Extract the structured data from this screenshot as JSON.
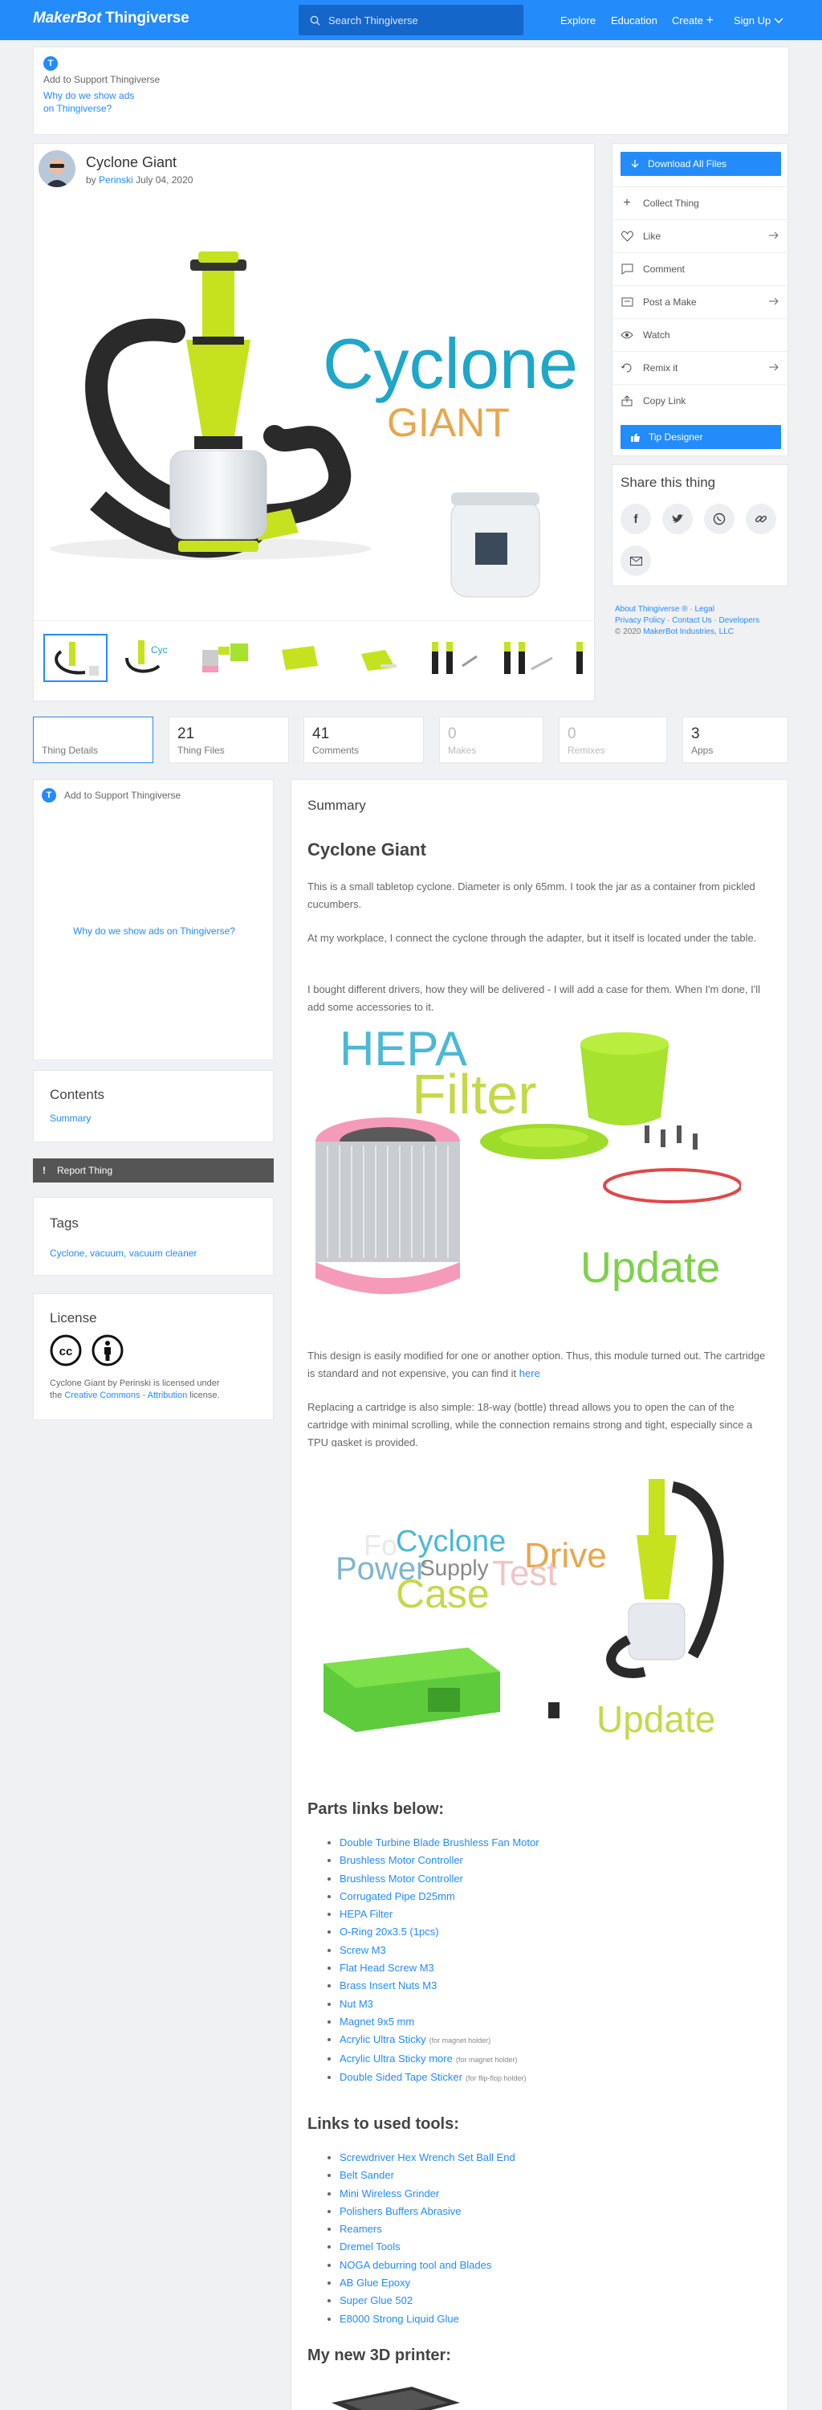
{
  "header": {
    "logo_a": "MakerBot",
    "logo_b": "Thingiverse",
    "search_placeholder": "Search Thingiverse",
    "nav": [
      "Explore",
      "Education",
      "Create",
      "Sign Up"
    ]
  },
  "ad_top": {
    "support": "Add to Support Thingiverse",
    "why_line1": "Why do we show ads",
    "why_line2": "on Thingiverse?"
  },
  "thing": {
    "title": "Cyclone Giant",
    "by": "by",
    "author": "Perinski",
    "date": "July 04, 2020",
    "hero_word1": "Cyclone",
    "hero_word2": "GIANT"
  },
  "actions": {
    "download": "Download All Files",
    "items": [
      "Collect Thing",
      "Like",
      "Comment",
      "Post a Make",
      "Watch",
      "Remix it",
      "Copy Link"
    ],
    "tip": "Tip Designer"
  },
  "share": {
    "title": "Share this thing"
  },
  "footer_links": {
    "line1a": "About Thingiverse ®",
    "line1b": "Legal",
    "line2a": "Privacy Policy",
    "line2b": "Contact Us",
    "line2c": "Developers",
    "copy": "© 2020",
    "company": "MakerBot Industries, LLC"
  },
  "tabs": [
    {
      "num": "",
      "label": "Thing Details"
    },
    {
      "num": "21",
      "label": "Thing Files"
    },
    {
      "num": "41",
      "label": "Comments"
    },
    {
      "num": "0",
      "label": "Makes"
    },
    {
      "num": "0",
      "label": "Remixes"
    },
    {
      "num": "3",
      "label": "Apps"
    }
  ],
  "side_ad": {
    "support": "Add to Support Thingiverse",
    "why": "Why do we show ads on Thingiverse?"
  },
  "contents": {
    "title": "Contents",
    "summary": "Summary"
  },
  "report": "Report Thing",
  "tags": {
    "title": "Tags",
    "list": "Cyclone, vacuum, vacuum cleaner"
  },
  "license": {
    "title": "License",
    "text1": "Cyclone Giant by Perinski is licensed under",
    "text2": "the",
    "link": "Creative Commons - Attribution",
    "text3": "license."
  },
  "summary": {
    "label": "Summary",
    "title": "Cyclone Giant",
    "p1": "This is a small tabletop cyclone. Diameter is only 65mm. I took the jar as a container from pickled cucumbers.",
    "p2": "At my workplace, I connect the cyclone through the adapter, but it itself is located under the table.",
    "p3": "I bought different drivers, how they will be delivered - I will add a case for them. When I'm done, I'll add some accessories to it.",
    "img1_w1": "HEPA",
    "img1_w2": "Filter",
    "img1_w3": "Update",
    "p4": "This design is easily modified for one or another option. Thus, this module turned out. The cartridge is standard and not expensive, you can find it",
    "p4_link": "here",
    "p5": "Replacing a cartridge is also simple: 18-way (bottle) thread allows you to open the can of the cartridge with minimal scrolling, while the connection remains strong and tight, especially since a TPU gasket is provided.",
    "img2_words": [
      "Fo",
      "Power",
      "Cyclone",
      "Supply",
      "Drive",
      "Case",
      "Test",
      "Update"
    ]
  },
  "parts": {
    "title": "Parts links below:",
    "items": [
      {
        "t": "Double Turbine Blade Brushless Fan Motor",
        "n": ""
      },
      {
        "t": "Brushless Motor Controller",
        "n": ""
      },
      {
        "t": "Brushless Motor Controller",
        "n": ""
      },
      {
        "t": "Corrugated Pipe D25mm",
        "n": ""
      },
      {
        "t": "HEPA Filter",
        "n": ""
      },
      {
        "t": "O-Ring 20x3.5 (1pcs)",
        "n": ""
      },
      {
        "t": "Screw M3",
        "n": ""
      },
      {
        "t": "Flat Head Screw M3",
        "n": ""
      },
      {
        "t": "Brass Insert Nuts M3",
        "n": ""
      },
      {
        "t": "Nut M3",
        "n": ""
      },
      {
        "t": "Magnet 9x5 mm",
        "n": ""
      },
      {
        "t": "Acrylic Ultra Sticky",
        "n": "(for magnet holder)"
      },
      {
        "t": "Acrylic Ultra Sticky more",
        "n": "(for magnet holder)"
      },
      {
        "t": "Double Sided Tape Sticker",
        "n": "(for flip-flop holder)"
      }
    ]
  },
  "tools": {
    "title": "Links to used tools:",
    "items": [
      "Screwdriver Hex Wrench Set Ball End",
      "Belt Sander",
      "Mini Wireless Grinder",
      "Polishers Buffers Abrasive",
      "Reamers",
      "Dremel Tools",
      "NOGA deburring tool and Blades",
      "AB Glue Epoxy",
      "Super Glue 502",
      "E8000 Strong Liquid Glue"
    ]
  },
  "printer": {
    "title": "My new 3D printer:"
  },
  "colors": {
    "brand": "#248bfb",
    "lime": "#c6e21e",
    "cyan": "#1fa6c9",
    "orange": "#e8a64c"
  }
}
